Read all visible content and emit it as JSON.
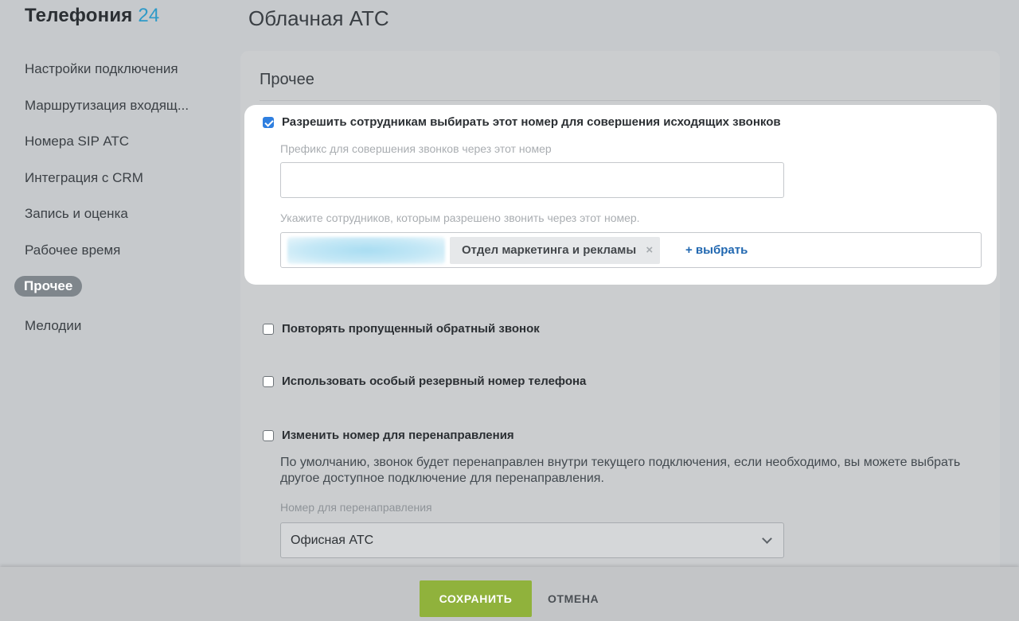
{
  "brand": {
    "name": "Телефония",
    "number": "24"
  },
  "page_title": "Облачная АТС",
  "sidebar": {
    "items": [
      {
        "label": "Настройки подключения"
      },
      {
        "label": "Маршрутизация входящ..."
      },
      {
        "label": "Номера SIP АТС"
      },
      {
        "label": "Интеграция с CRM"
      },
      {
        "label": "Запись и оценка"
      },
      {
        "label": "Рабочее время"
      },
      {
        "label": "Прочее",
        "active": true
      },
      {
        "label": "Мелодии"
      }
    ]
  },
  "section": {
    "title": "Прочее",
    "allow_outgoing": {
      "checked": true,
      "label": "Разрешить сотрудникам выбирать этот номер для совершения исходящих звонков",
      "prefix_hint": "Префикс для совершения звонков через этот номер",
      "prefix_value": "",
      "employees_hint": "Укажите сотрудников, которым разрешено звонить через этот номер.",
      "employees_tag": "Отдел маркетинга и рекламы",
      "remove_symbol": "×",
      "add_link": "+ выбрать"
    },
    "repeat_missed": {
      "checked": false,
      "label": "Повторять пропущенный обратный звонок"
    },
    "backup_number": {
      "checked": false,
      "label": "Использовать особый резервный номер телефона"
    },
    "redirect_number": {
      "checked": false,
      "label": "Изменить номер для перенаправления",
      "description": "По умолчанию, звонок будет перенаправлен внутри текущего подключения, если необходимо, вы можете выбрать другое доступное подключение для перенаправления.",
      "select_hint": "Номер для перенаправления",
      "select_value": "Офисная АТС"
    }
  },
  "footer": {
    "save_label": "СОХРАНИТЬ",
    "cancel_label": "ОТМЕНА"
  },
  "colors": {
    "accent": "#2f7fe0",
    "save_button": "#90b23c",
    "brand_number": "#2e9ac8",
    "link": "#2067b0"
  }
}
